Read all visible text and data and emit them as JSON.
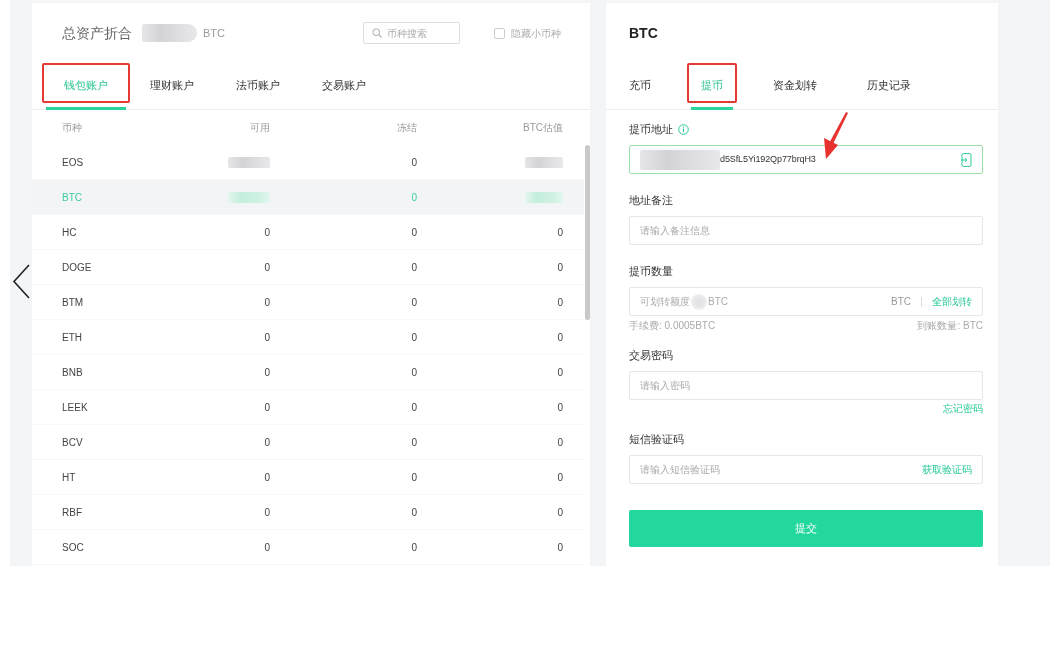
{
  "left_panel": {
    "total": {
      "label": "总资产折合",
      "value_redacted": true,
      "unit": "BTC"
    },
    "search": {
      "placeholder": "币种搜索"
    },
    "hide_small": {
      "label": "隐藏小币种",
      "checked": false
    },
    "tabs": [
      {
        "label": "钱包账户",
        "selected": true,
        "highlighted": true
      },
      {
        "label": "理财账户",
        "selected": false,
        "highlighted": false
      },
      {
        "label": "法币账户",
        "selected": false,
        "highlighted": false
      },
      {
        "label": "交易账户",
        "selected": false,
        "highlighted": false
      }
    ],
    "table": {
      "columns": [
        "币种",
        "可用",
        "冻结",
        "BTC估值"
      ],
      "rows": [
        {
          "coin": "EOS",
          "available": {
            "redacted": true
          },
          "frozen": "0",
          "btc_value": {
            "redacted": true
          },
          "selected": false
        },
        {
          "coin": "BTC",
          "available": {
            "redacted": true
          },
          "frozen": "0",
          "btc_value": {
            "redacted": true
          },
          "selected": true
        },
        {
          "coin": "HC",
          "available": "0",
          "frozen": "0",
          "btc_value": "0",
          "selected": false
        },
        {
          "coin": "DOGE",
          "available": "0",
          "frozen": "0",
          "btc_value": "0",
          "selected": false
        },
        {
          "coin": "BTM",
          "available": "0",
          "frozen": "0",
          "btc_value": "0",
          "selected": false
        },
        {
          "coin": "ETH",
          "available": "0",
          "frozen": "0",
          "btc_value": "0",
          "selected": false
        },
        {
          "coin": "BNB",
          "available": "0",
          "frozen": "0",
          "btc_value": "0",
          "selected": false
        },
        {
          "coin": "LEEK",
          "available": "0",
          "frozen": "0",
          "btc_value": "0",
          "selected": false
        },
        {
          "coin": "BCV",
          "available": "0",
          "frozen": "0",
          "btc_value": "0",
          "selected": false
        },
        {
          "coin": "HT",
          "available": "0",
          "frozen": "0",
          "btc_value": "0",
          "selected": false
        },
        {
          "coin": "RBF",
          "available": "0",
          "frozen": "0",
          "btc_value": "0",
          "selected": false
        },
        {
          "coin": "SOC",
          "available": "0",
          "frozen": "0",
          "btc_value": "0",
          "selected": false
        }
      ]
    }
  },
  "right_panel": {
    "title": "BTC",
    "tabs": [
      {
        "label": "充币",
        "selected": false,
        "highlighted": false
      },
      {
        "label": "提币",
        "selected": true,
        "highlighted": true
      },
      {
        "label": "资金划转",
        "selected": false,
        "highlighted": false
      },
      {
        "label": "历史记录",
        "selected": false,
        "highlighted": false
      }
    ],
    "address": {
      "label": "提币地址",
      "info": true,
      "value_redacted": true,
      "value": "d5SfL5Yi192Qp77brqH3",
      "focused": true,
      "arrow": true
    },
    "note": {
      "label": "地址备注",
      "placeholder": "请输入备注信息"
    },
    "amount": {
      "label": "提币数量",
      "placeholder_prefix": "可划转额度",
      "placeholder_redacted": true,
      "placeholder_suffix": "BTC",
      "unit": "BTC",
      "action": "全部划转",
      "fee": "手续费: 0.0005BTC",
      "received": "到账数量: BTC"
    },
    "password": {
      "label": "交易密码",
      "placeholder": "请输入密码",
      "link": "忘记密码"
    },
    "sms": {
      "label": "短信验证码",
      "placeholder": "请输入短信验证码",
      "action": "获取验证码"
    },
    "submit": "提交"
  }
}
